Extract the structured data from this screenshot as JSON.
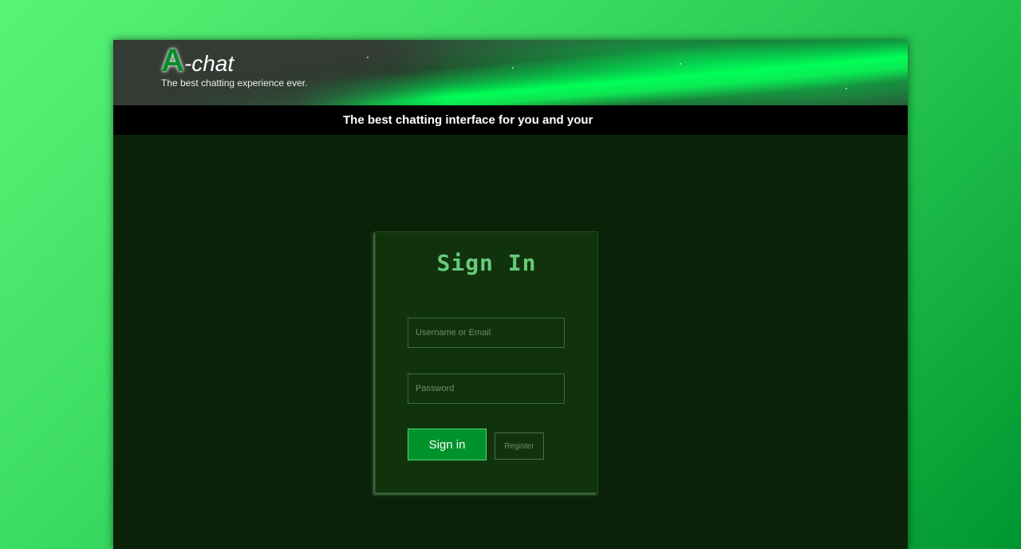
{
  "header": {
    "logo_initial": "A",
    "logo_rest": "-chat",
    "tagline": "The best chatting experience ever."
  },
  "marquee": {
    "text": "The best chatting interface for you and your"
  },
  "signin": {
    "title": "Sign In",
    "username_placeholder": "Username or Email",
    "username_value": "",
    "password_placeholder": "Password",
    "password_value": "",
    "signin_label": "Sign in",
    "register_label": "Register"
  },
  "colors": {
    "brand_green": "#00932b",
    "title_green": "#66cc7a",
    "panel_bg": "#0a2308",
    "card_bg": "#10330e"
  }
}
